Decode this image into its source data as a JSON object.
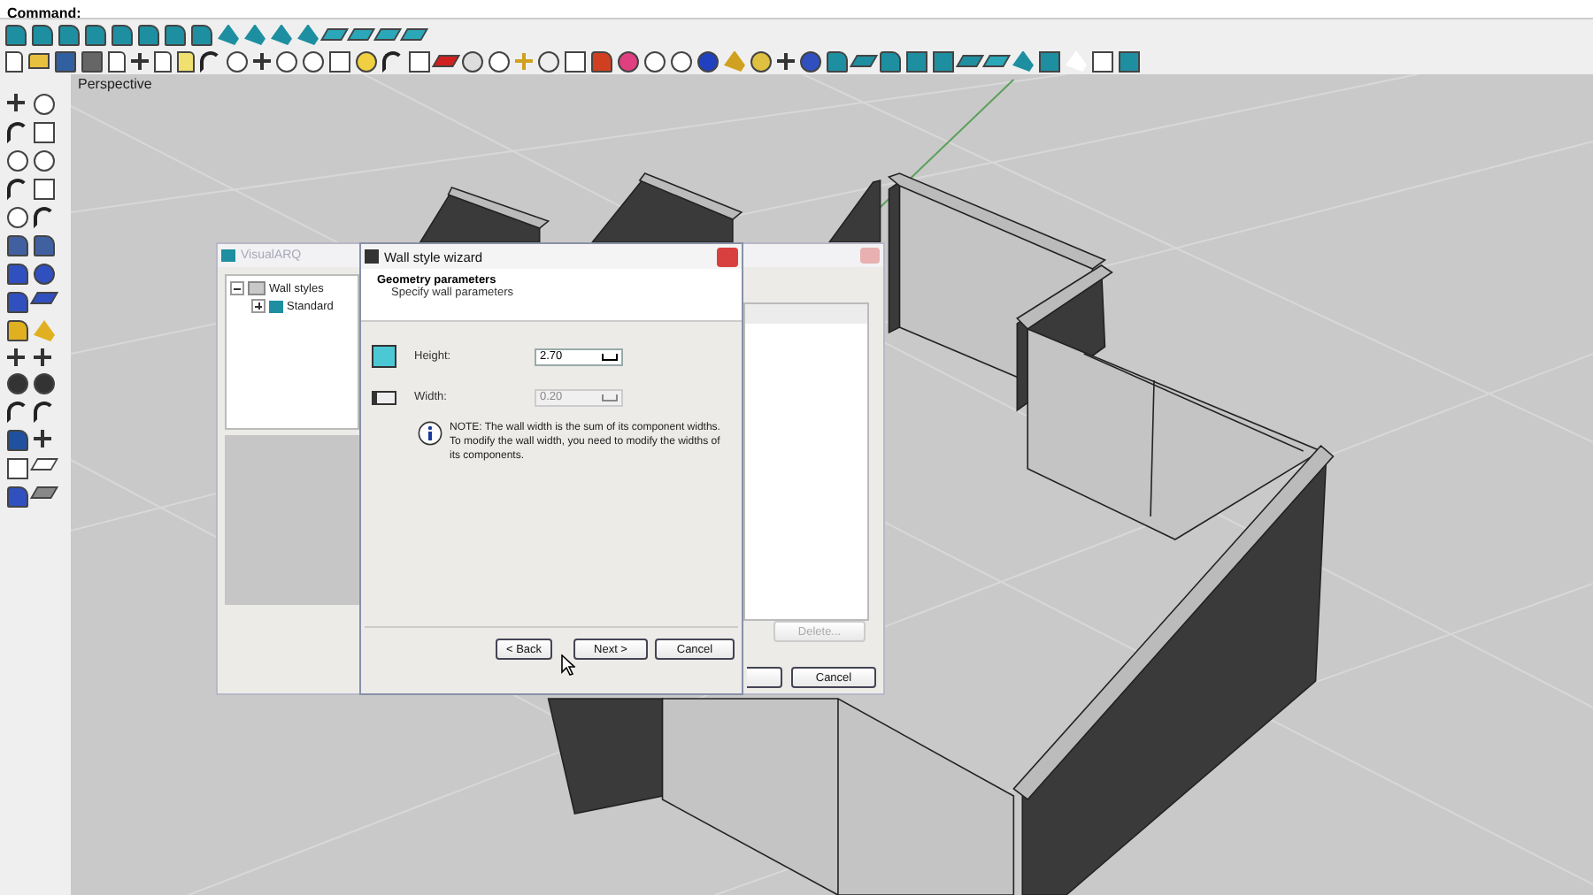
{
  "command_line": {
    "prompt": "Command:"
  },
  "viewport": {
    "label": "Perspective"
  },
  "back_dialog": {
    "title": "VisualARQ",
    "tree": [
      {
        "label": "Wall styles",
        "expanded": true,
        "children": [
          {
            "label": "Standard",
            "expanded": false
          }
        ]
      }
    ],
    "buttons": [
      {
        "label": "Delete...",
        "disabled": true
      },
      {
        "label": "Cancel",
        "disabled": false
      }
    ]
  },
  "wizard": {
    "title": "Wall style wizard",
    "heading": "Geometry parameters",
    "subheading": "Specify wall parameters",
    "fields": [
      {
        "label": "Height:",
        "value": "2.70",
        "disabled": false
      },
      {
        "label": "Width:",
        "value": "0.20",
        "disabled": true
      }
    ],
    "note": "NOTE: The wall width is the sum of its component widths. To modify the wall width, you need to modify the widths of its components.",
    "buttons": [
      {
        "label": "< Back"
      },
      {
        "label": "Next >"
      },
      {
        "label": "Cancel"
      }
    ]
  }
}
